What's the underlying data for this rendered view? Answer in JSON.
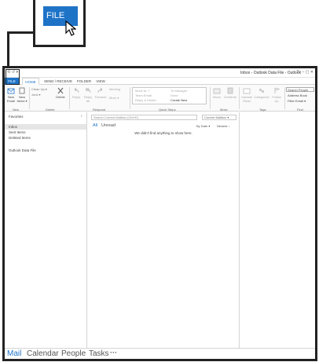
{
  "callout": {
    "file_label": "FILE"
  },
  "window": {
    "title": "Inbox - Outlook Data File - Outlook",
    "quick_access": "⟲ ↺ ▾",
    "controls": "? ▫ – ▢ ✕"
  },
  "tabs": {
    "file": "FILE",
    "home": "HOME",
    "send_receive": "SEND / RECEIVE",
    "folder": "FOLDER",
    "view": "VIEW"
  },
  "ribbon": {
    "new_email": "New Email",
    "new_items": "New Items ▾",
    "clean_up": "Clean Up ▾",
    "junk": "Junk ▾",
    "delete": "Delete",
    "reply": "Reply",
    "reply_all": "Reply All",
    "forward": "Forward",
    "meeting": "Meeting",
    "more": "More ▾",
    "quick_steps": [
      "Move to: ?",
      "Team Email",
      "Reply & Delete",
      "To Manager",
      "Done",
      "Create New"
    ],
    "move": "Move",
    "onenote": "OneNote",
    "unread_read": "Unread/ Read",
    "categorize": "Categorize",
    "follow_up": "Follow Up",
    "search_people": "Search People",
    "address_book": "Address Book",
    "filter_email": "Filter Email ▾",
    "groups": {
      "new": "New",
      "delete": "Delete",
      "respond": "Respond",
      "quick_steps": "Quick Steps",
      "move": "Move",
      "tags": "Tags",
      "find": "Find"
    }
  },
  "folder_pane": {
    "favorites": "Favorites",
    "items": [
      "Inbox",
      "Sent Items",
      "Deleted Items"
    ],
    "data_file": "Outlook Data File"
  },
  "message_list": {
    "search_placeholder": "Search Current Mailbox (Ctrl+E)",
    "scope": "Current Mailbox ▾",
    "filter_all": "All",
    "filter_unread": "Unread",
    "sort_by": "By Date ▾",
    "sort_order": "Newest ↓",
    "empty_text": "We didn't find anything to show here."
  },
  "nav": {
    "mail": "Mail",
    "calendar": "Calendar",
    "people": "People",
    "tasks": "Tasks",
    "more": "···"
  },
  "colors": {
    "accent": "#1e73c7",
    "border": "#222222"
  }
}
